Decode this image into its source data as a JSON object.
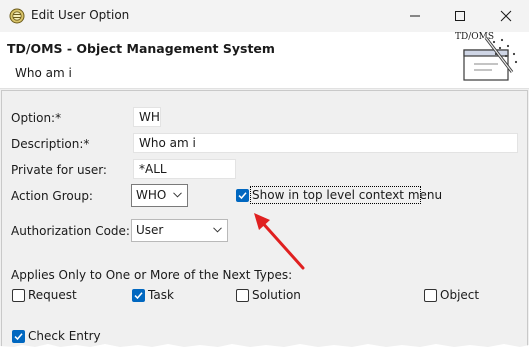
{
  "window": {
    "title": "Edit User Option",
    "icon": "eclipse-icon",
    "controls": [
      "minimize-icon",
      "maximize-icon",
      "close-icon"
    ]
  },
  "banner": {
    "title": "TD/OMS - Object Management System",
    "subtitle": "Who am i",
    "logo_text": "TD/OMS"
  },
  "form": {
    "option": {
      "label": "Option:*",
      "value": "WH"
    },
    "description": {
      "label": "Description:*",
      "value": "Who am i"
    },
    "private_for_user": {
      "label": "Private for user:",
      "value": "*ALL"
    },
    "action_group": {
      "label": "Action Group:",
      "value": "WHO"
    },
    "show_in_top_level": {
      "label": "Show in top level context menu",
      "checked": true
    },
    "authorization_code": {
      "label": "Authorization Code:",
      "value": "User"
    },
    "applies_heading": "Applies Only to One or More of the Next Types:",
    "types": [
      {
        "label": "Request",
        "checked": false
      },
      {
        "label": "Task",
        "checked": true
      },
      {
        "label": "Solution",
        "checked": false
      },
      {
        "label": "Object",
        "checked": false
      }
    ],
    "check_entry": {
      "label": "Check Entry",
      "checked": true
    }
  },
  "colors": {
    "accent": "#0067c0",
    "arrow": "#e02020",
    "dialog_bg": "#f0f0f0"
  }
}
